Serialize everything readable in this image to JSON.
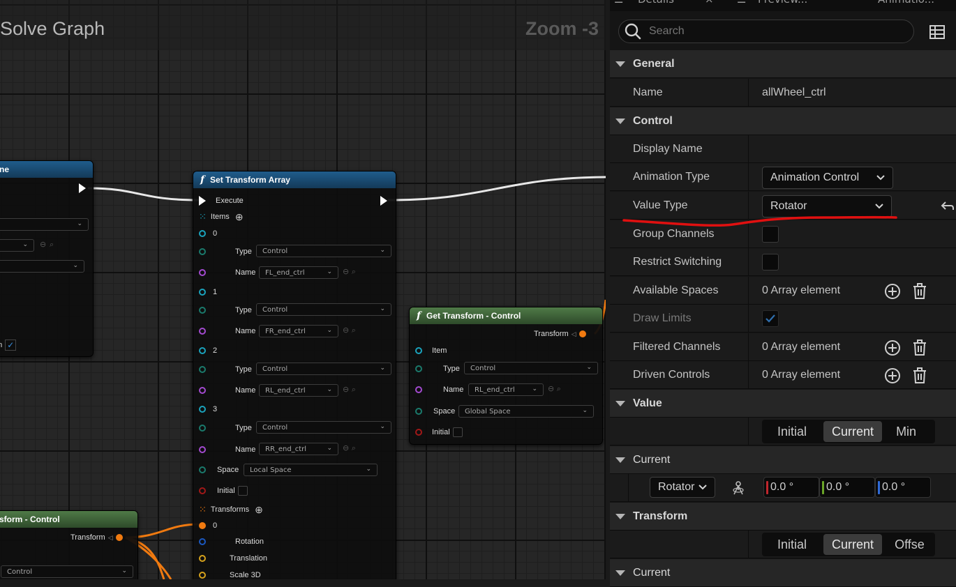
{
  "graph": {
    "title": "Solve Graph",
    "zoom": "Zoom -3"
  },
  "left_node": {
    "title": "ne",
    "checkbox_label": "en"
  },
  "set_transform_array": {
    "title": "Set Transform Array",
    "execute": "Execute",
    "items_label": "Items",
    "items": [
      {
        "index": "0",
        "type_label": "Type",
        "type": "Control",
        "name_label": "Name",
        "name": "FL_end_ctrl"
      },
      {
        "index": "1",
        "type_label": "Type",
        "type": "Control",
        "name_label": "Name",
        "name": "FR_end_ctrl"
      },
      {
        "index": "2",
        "type_label": "Type",
        "type": "Control",
        "name_label": "Name",
        "name": "RL_end_ctrl"
      },
      {
        "index": "3",
        "type_label": "Type",
        "type": "Control",
        "name_label": "Name",
        "name": "RR_end_ctrl"
      }
    ],
    "space_label": "Space",
    "space": "Local Space",
    "initial_label": "Initial",
    "transforms_label": "Transforms",
    "transform0_index": "0",
    "rotation_label": "Rotation",
    "translation_label": "Translation",
    "scale_label": "Scale 3D"
  },
  "get_transform": {
    "title": "Get Transform - Control",
    "transform_out": "Transform",
    "item_label": "Item",
    "type_label": "Type",
    "type": "Control",
    "name_label": "Name",
    "name": "RL_end_ctrl",
    "space_label": "Space",
    "space": "Global Space",
    "initial_label": "Initial"
  },
  "bottom_node": {
    "title": "sform - Control",
    "transform_out": "Transform",
    "dropdown": "Control"
  },
  "details": {
    "tabs": [
      "Details",
      "Preview...",
      "Animatio..."
    ],
    "search_placeholder": "Search",
    "general_header": "General",
    "name_label": "Name",
    "name_value": "allWheel_ctrl",
    "control_header": "Control",
    "display_name_label": "Display Name",
    "animation_type_label": "Animation Type",
    "animation_type_value": "Animation Control",
    "value_type_label": "Value Type",
    "value_type_value": "Rotator",
    "group_channels_label": "Group Channels",
    "restrict_switching_label": "Restrict Switching",
    "available_spaces_label": "Available Spaces",
    "available_spaces_value": "0 Array element",
    "draw_limits_label": "Draw Limits",
    "filtered_channels_label": "Filtered Channels",
    "filtered_channels_value": "0 Array element",
    "driven_controls_label": "Driven Controls",
    "driven_controls_value": "0 Array element",
    "value_header": "Value",
    "value_segments": [
      "Initial",
      "Current",
      "Min"
    ],
    "current_header": "Current",
    "rotator_combo": "Rotator",
    "rot_x": "0.0 °",
    "rot_y": "0.0 °",
    "rot_z": "0.0 °",
    "transform_header": "Transform",
    "transform_segments": [
      "Initial",
      "Current",
      "Offse"
    ],
    "current_header_2": "Current"
  },
  "colors": {
    "annotation": "#e01010",
    "exec_wire": "#ffffff",
    "transform_wire": "#f07a10"
  }
}
